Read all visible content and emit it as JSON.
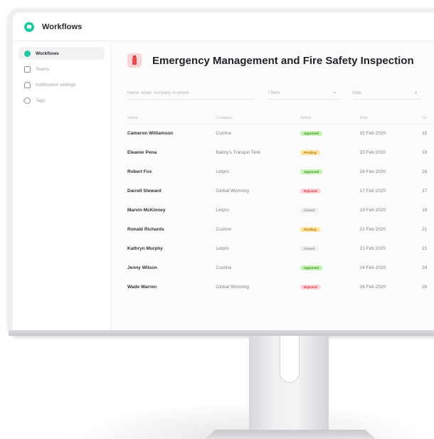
{
  "app": {
    "title": "Workflows",
    "logo_icon": "workflow-logo-icon",
    "accent": "#22c7a4"
  },
  "sidebar": {
    "items": [
      {
        "label": "Workflows",
        "icon": "workflow-icon",
        "active": true
      },
      {
        "label": "Teams",
        "icon": "team-icon",
        "active": false
      },
      {
        "label": "Notification settings",
        "icon": "bell-icon",
        "active": false
      },
      {
        "label": "Tags",
        "icon": "tag-icon",
        "active": false
      }
    ]
  },
  "main": {
    "title": "Emergency Management and Fire Safety Inspection",
    "title_icon": "fire-extinguisher-icon",
    "search": {
      "placeholder": "Name, email, company or phone",
      "value": ""
    },
    "filters": [
      {
        "label": "Filters"
      },
      {
        "label": "Date"
      }
    ]
  },
  "table": {
    "columns": [
      "Name",
      "Company",
      "Status",
      "Date",
      "Da"
    ],
    "rows": [
      {
        "name": "Cameron Williamson",
        "company": "Cuizine",
        "status": "Approved",
        "date": "15 Feb 2020",
        "date2": "15"
      },
      {
        "name": "Eleanor Pena",
        "company": "Balmy's Tranquil Tank",
        "status": "Pending",
        "date": "15 Feb 2020",
        "date2": "19"
      },
      {
        "name": "Robert Fox",
        "company": "Letpro",
        "status": "Approved",
        "date": "16 Feb 2020",
        "date2": "16"
      },
      {
        "name": "Darrell Steward",
        "company": "Global Worming",
        "status": "Rejected",
        "date": "17 Feb 2020",
        "date2": "17"
      },
      {
        "name": "Marvin McKinney",
        "company": "Letpro",
        "status": "Closed",
        "date": "19 Feb 2020",
        "date2": "19"
      },
      {
        "name": "Ronald Richards",
        "company": "Cuizine",
        "status": "Pending",
        "date": "21 Feb 2020",
        "date2": "21"
      },
      {
        "name": "Kathryn Murphy",
        "company": "Letpro",
        "status": "Closed",
        "date": "21 Feb 2020",
        "date2": "21"
      },
      {
        "name": "Jenny Wilson",
        "company": "Cuizine",
        "status": "Approved",
        "date": "24 Feb 2020",
        "date2": "24"
      },
      {
        "name": "Wade Warren",
        "company": "Global Worming",
        "status": "Rejected",
        "date": "26 Feb 2020",
        "date2": "26"
      }
    ]
  },
  "status_colors": {
    "Approved": "#3e8d1f",
    "Pending": "#b07a06",
    "Rejected": "#d23445",
    "Closed": "#8d9197"
  }
}
